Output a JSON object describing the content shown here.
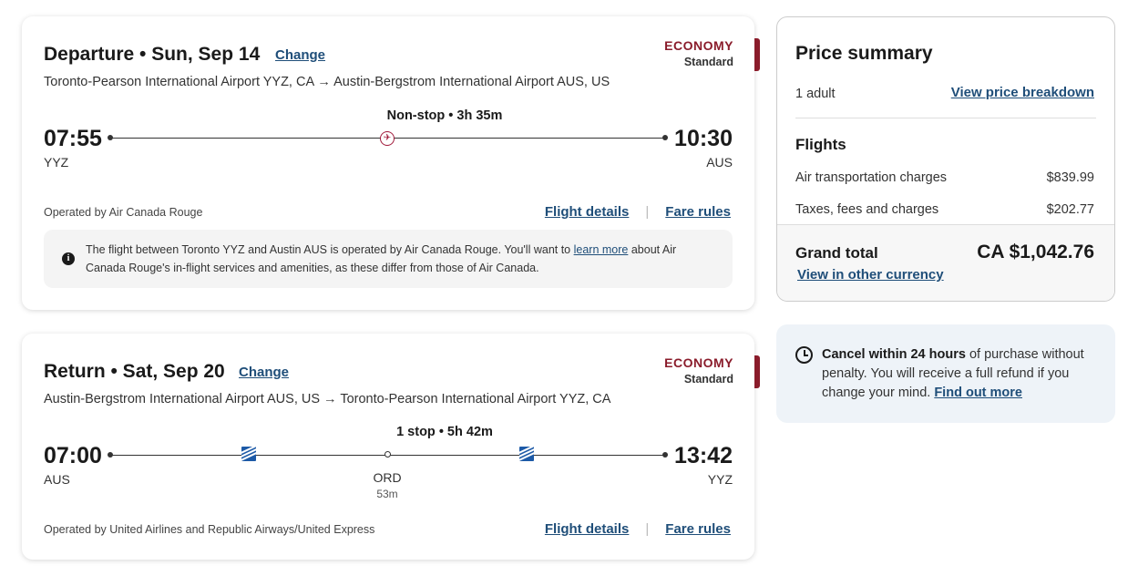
{
  "departure": {
    "title": "Departure • Sun, Sep 14",
    "change_label": "Change",
    "route": "Toronto-Pearson International Airport YYZ, CA → Austin-Bergstrom International Airport AUS, US",
    "cabin": "ECONOMY",
    "fare_type": "Standard",
    "summary": "Non-stop  •  3h 35m",
    "depart_time": "07:55",
    "depart_code": "YYZ",
    "arrive_time": "10:30",
    "arrive_code": "AUS",
    "carrier_icon": "air-canada-rouge-icon",
    "operated_by": "Operated by Air Canada Rouge",
    "flight_details_label": "Flight details",
    "fare_rules_label": "Fare rules",
    "notice": {
      "text_before": "The flight between Toronto YYZ and Austin AUS is operated by Air Canada Rouge. You'll want to ",
      "link": "learn more",
      "text_after": " about Air Canada Rouge's in-flight services and amenities, as these differ from those of Air Canada."
    }
  },
  "return": {
    "title": "Return • Sat, Sep 20",
    "change_label": "Change",
    "route": "Austin-Bergstrom International Airport AUS, US → Toronto-Pearson International Airport YYZ, CA",
    "cabin": "ECONOMY",
    "fare_type": "Standard",
    "summary": "1 stop  •  5h 42m",
    "depart_time": "07:00",
    "depart_code": "AUS",
    "arrive_time": "13:42",
    "arrive_code": "YYZ",
    "stop_code": "ORD",
    "stop_duration": "53m",
    "carrier_icon": "united-airlines-icon",
    "operated_by": "Operated by United Airlines and Republic Airways/United Express",
    "flight_details_label": "Flight details",
    "fare_rules_label": "Fare rules"
  },
  "price_summary": {
    "title": "Price summary",
    "passengers": "1 adult",
    "breakdown_link": "View price breakdown",
    "section_title": "Flights",
    "rows": [
      {
        "label": "Air transportation charges",
        "amount": "$839.99"
      },
      {
        "label": "Taxes, fees and charges",
        "amount": "$202.77"
      }
    ],
    "total_label": "Grand total",
    "total_amount": "CA $1,042.76",
    "currency_link": "View in other currency"
  },
  "cancel": {
    "bold": "Cancel within 24 hours",
    "text": " of purchase without penalty. You will receive a full refund if you change your mind. ",
    "link": "Find out more"
  },
  "colors": {
    "accent": "#8a1c2b",
    "link": "#1f4e79",
    "cancel_bg": "#eef3f8"
  }
}
